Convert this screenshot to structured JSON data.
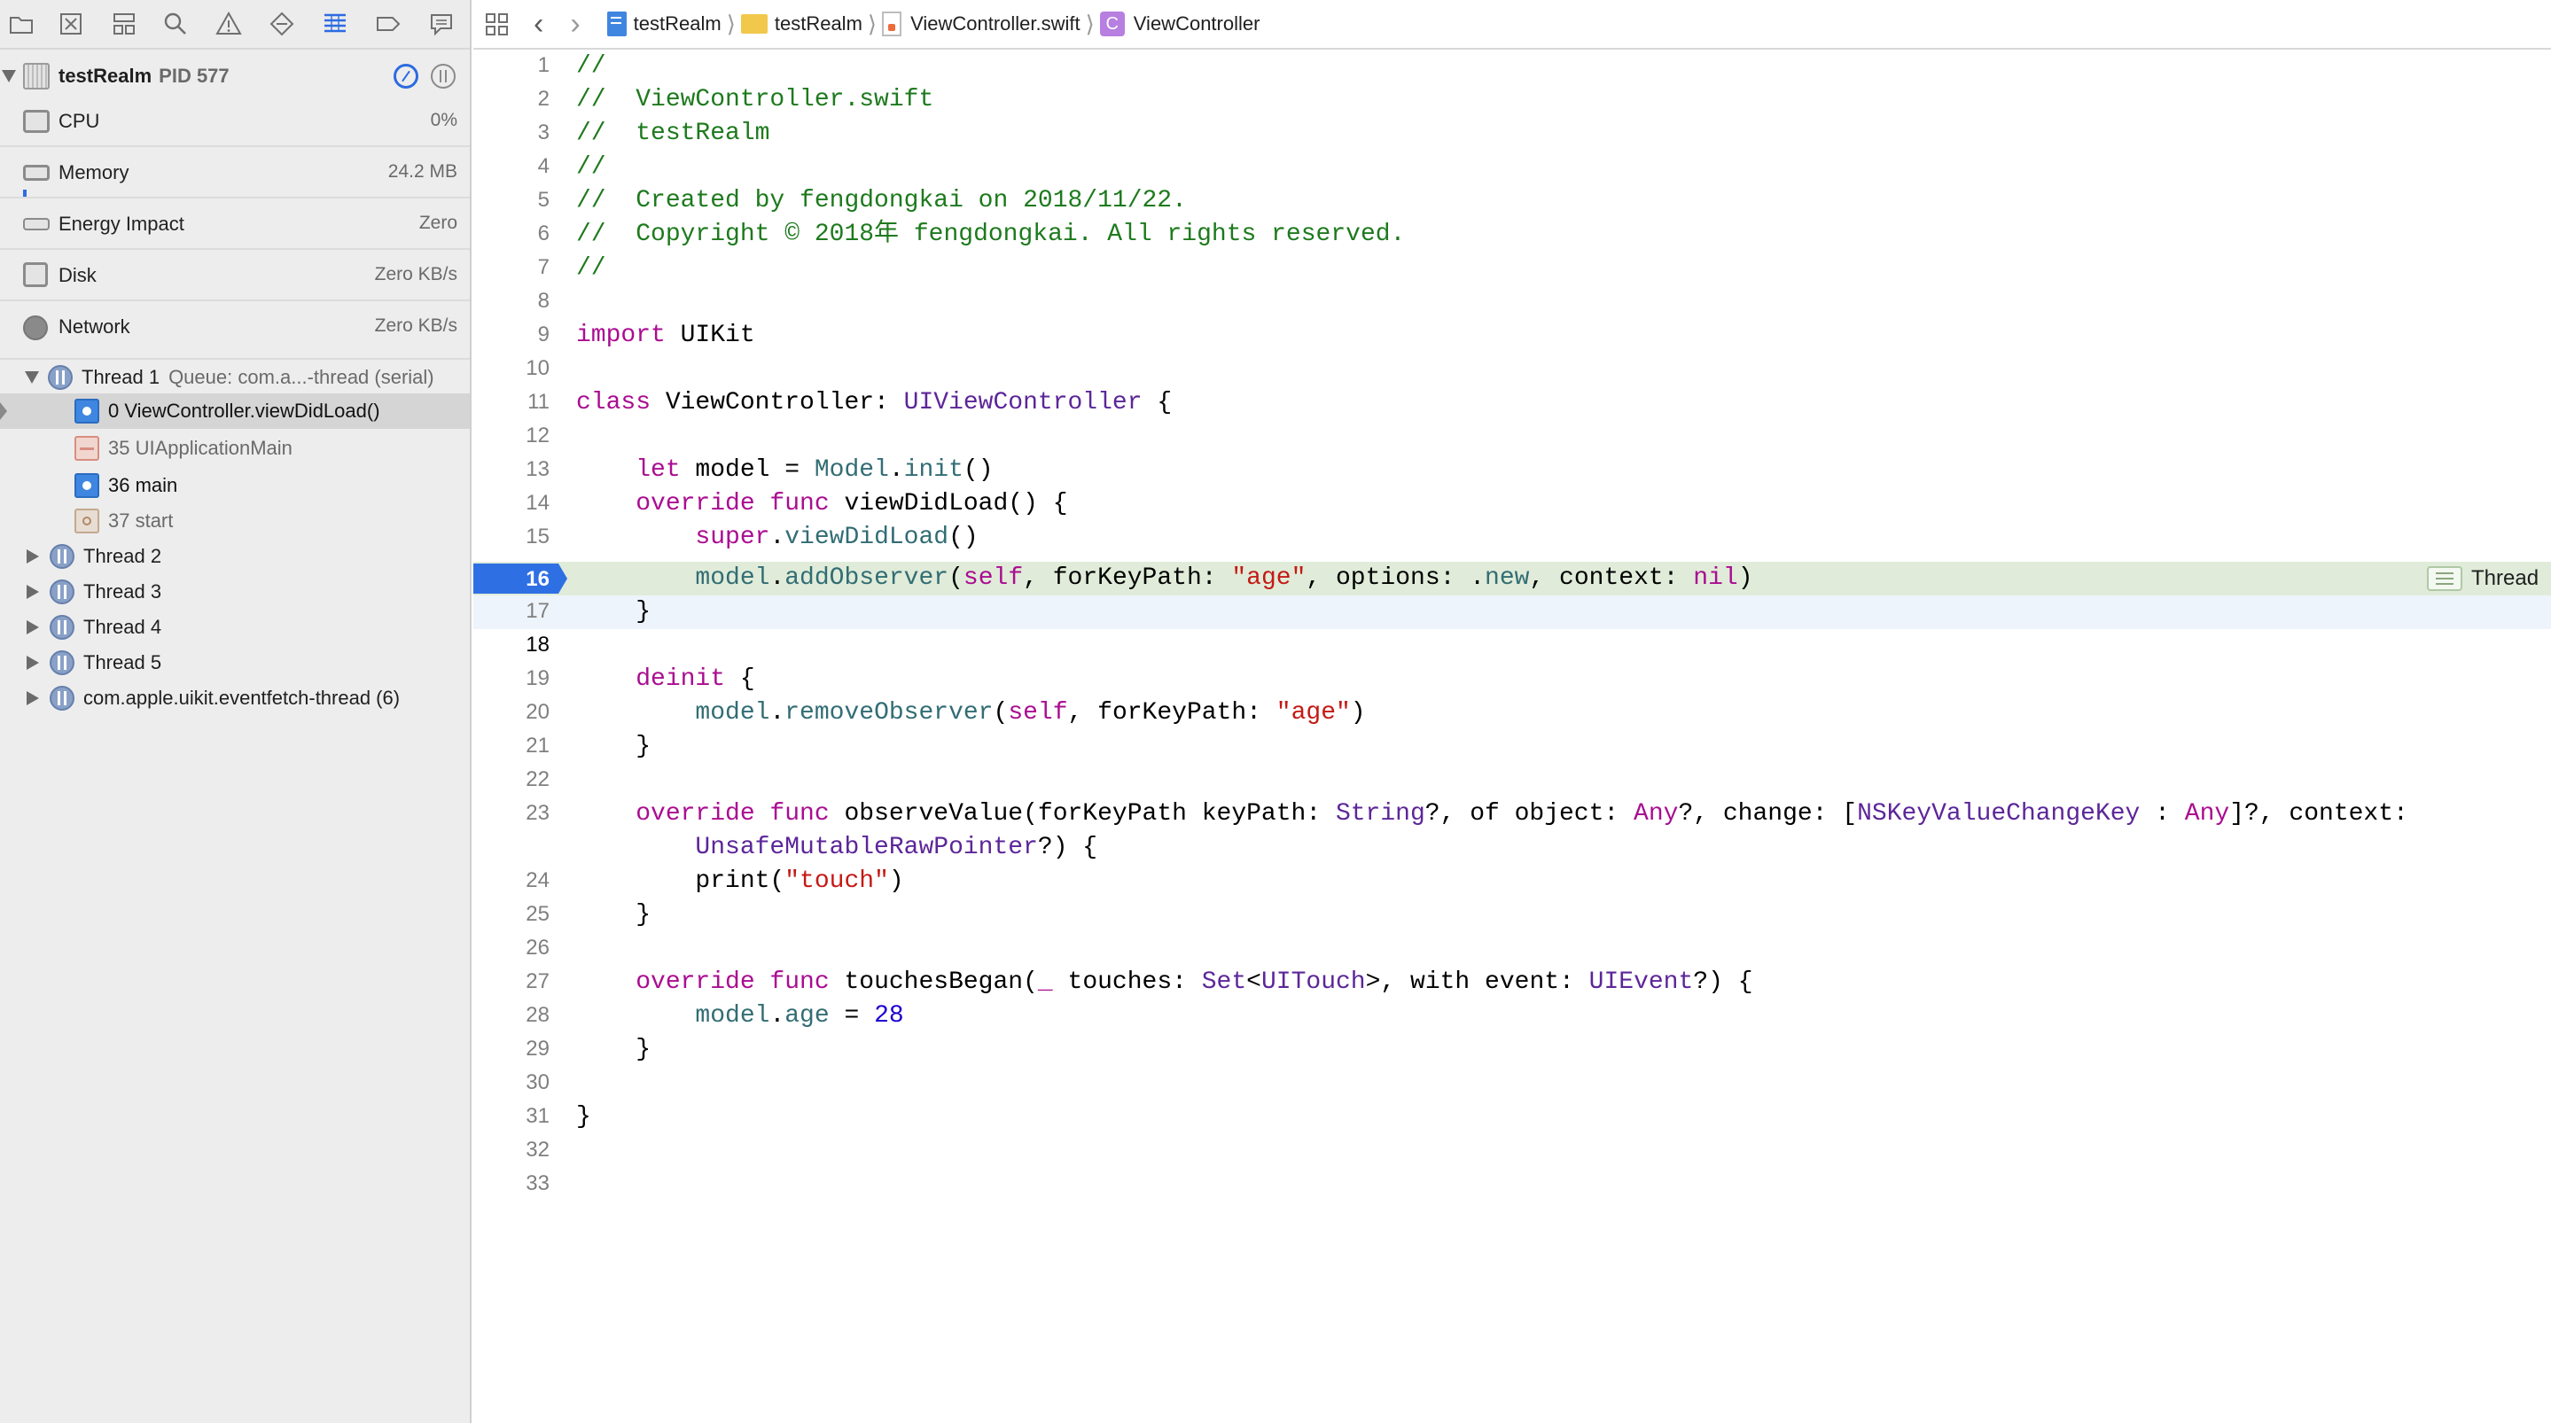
{
  "navigator": {
    "tabs": [
      "folder-icon",
      "source-control-icon",
      "symbol-icon",
      "search-icon",
      "issue-icon",
      "test-icon",
      "debug-icon",
      "breakpoint-icon",
      "report-icon"
    ],
    "process": {
      "name": "testRealm",
      "pid": "PID 577"
    },
    "gauges": [
      {
        "label": "CPU",
        "value": "0%"
      },
      {
        "label": "Memory",
        "value": "24.2 MB"
      },
      {
        "label": "Energy Impact",
        "value": "Zero"
      },
      {
        "label": "Disk",
        "value": "Zero KB/s"
      },
      {
        "label": "Network",
        "value": "Zero KB/s"
      }
    ],
    "thread1": {
      "name": "Thread 1",
      "queue": "Queue: com.a...-thread (serial)"
    },
    "frames": [
      {
        "label": "0 ViewController.viewDidLoad()",
        "selected": true
      },
      {
        "label": "35 UIApplicationMain",
        "selected": false
      },
      {
        "label": "36 main",
        "selected": false
      },
      {
        "label": "37 start",
        "selected": false
      }
    ],
    "threads": [
      "Thread 2",
      "Thread 3",
      "Thread 4",
      "Thread 5",
      "com.apple.uikit.eventfetch-thread (6)"
    ]
  },
  "jump_bar": {
    "project": "testRealm",
    "folder": "testRealm",
    "file": "ViewController.swift",
    "symbol_badge": "C",
    "symbol": "ViewController"
  },
  "editor": {
    "current_pc_line": "16",
    "annotation": "Thread",
    "line_numbers": [
      "1",
      "2",
      "3",
      "4",
      "5",
      "6",
      "7",
      "8",
      "9",
      "10",
      "11",
      "12",
      "13",
      "14",
      "15",
      "16",
      "17",
      "18",
      "19",
      "20",
      "21",
      "22",
      "23",
      "24",
      "25",
      "26",
      "27",
      "28",
      "29",
      "30",
      "31",
      "32",
      "33"
    ],
    "lines": {
      "l1": "//",
      "l2": "//  ViewController.swift",
      "l3": "//  testRealm",
      "l4": "//",
      "l5": "//  Created by fengdongkai on 2018/11/22.",
      "l6": "//  Copyright © 2018年 fengdongkai. All rights reserved.",
      "l7": "//",
      "l9a": "import",
      "l9b": " UIKit",
      "l11a": "class",
      "l11b": " ViewController: ",
      "l11c": "UIViewController",
      "l11d": " {",
      "l13a": "    let",
      "l13b": " model = ",
      "l13c": "Model",
      "l13d": ".",
      "l13e": "init",
      "l13f": "()",
      "l14a": "    override func",
      "l14b": " viewDidLoad() {",
      "l15a": "        super",
      "l15b": ".",
      "l15c": "viewDidLoad",
      "l15d": "()",
      "l16a": "        model",
      "l16b": ".",
      "l16c": "addObserver",
      "l16d": "(",
      "l16e": "self",
      "l16f": ", forKeyPath: ",
      "l16g": "\"age\"",
      "l16h": ", options: .",
      "l16i": "new",
      "l16j": ", context: ",
      "l16k": "nil",
      "l16l": ")",
      "l17": "    }",
      "l19a": "    deinit",
      "l19b": " {",
      "l20a": "        model",
      "l20b": ".",
      "l20c": "removeObserver",
      "l20d": "(",
      "l20e": "self",
      "l20f": ", forKeyPath: ",
      "l20g": "\"age\"",
      "l20h": ")",
      "l21": "    }",
      "l23a": "    override func",
      "l23b": " observeValue(forKeyPath keyPath: ",
      "l23c": "String",
      "l23d": "?, of object: ",
      "l23e": "Any",
      "l23f": "?, change: [",
      "l23g": "NSKeyValueChangeKey",
      "l23h": " : ",
      "l23i": "Any",
      "l23j": "]?, context:",
      "l23wa": "        UnsafeMutableRawPointer",
      "l23wb": "?) {",
      "l24a": "        print(",
      "l24b": "\"touch\"",
      "l24c": ")",
      "l25": "    }",
      "l27a": "    override func",
      "l27b": " touchesBegan(",
      "l27c": "_",
      "l27d": " touches: ",
      "l27e": "Set",
      "l27f": "<",
      "l27g": "UITouch",
      "l27h": ">, with event: ",
      "l27i": "UIEvent",
      "l27j": "?) {",
      "l28a": "        model",
      "l28b": ".",
      "l28c": "age",
      "l28d": " = ",
      "l28e": "28",
      "l29": "    }",
      "l31": "}"
    }
  },
  "colors": {
    "comment": "#1d7a1d",
    "keyword": "#aa0d91",
    "type": "#5c2699",
    "member": "#326d74",
    "string": "#c41a16",
    "number": "#1c00cf",
    "pc_marker": "#2f6fe4",
    "pc_line_highlight": "#e0ecd9"
  }
}
